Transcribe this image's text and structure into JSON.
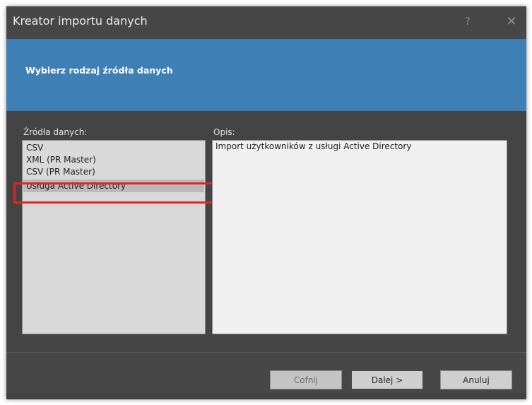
{
  "window": {
    "title": "Kreator importu danych",
    "help_label": "?",
    "close_label": "✕"
  },
  "header": {
    "title": "Wybierz rodzaj źródła danych"
  },
  "sources": {
    "label": "Źródła danych:",
    "items": [
      {
        "label": "CSV"
      },
      {
        "label": "XML (PR Master)"
      },
      {
        "label": "CSV (PR Master)"
      },
      {
        "label": "Usługa Active Directory"
      }
    ],
    "selected_index": 3
  },
  "description": {
    "label": "Opis:",
    "text": "Import użytkowników z usługi Active Directory"
  },
  "buttons": {
    "back": "Cofnij",
    "next": "Dalej >",
    "cancel": "Anuluj"
  },
  "colors": {
    "header_band": "#3e7fb5",
    "highlight": "#e8202a",
    "window_bg": "#424242"
  }
}
